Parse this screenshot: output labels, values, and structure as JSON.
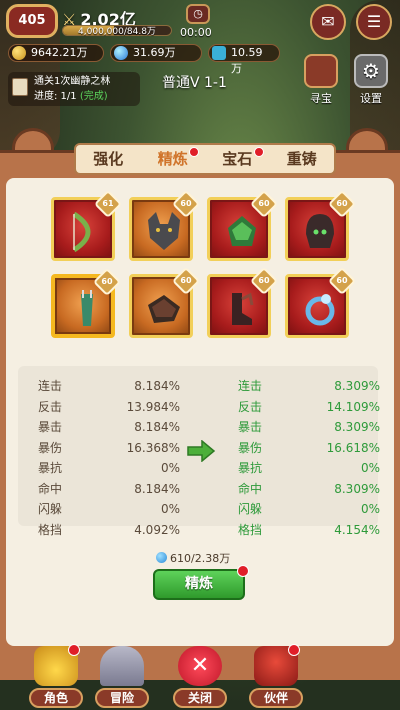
{
  "hud": {
    "level": "405",
    "power": "2.02亿",
    "exp_text": "4,000,000/84.8万",
    "exp_fraction": 0.47,
    "timer": "00:00",
    "gold": "9642.21万",
    "gems": "31.69万",
    "tickets": "10.59万"
  },
  "quest": {
    "title": "通关1次幽静之林",
    "progress_label": "进度: 1/1",
    "status": "(完成)"
  },
  "stage": "普通V 1-1",
  "side_buttons": {
    "treasure": "寻宝",
    "settings": "设置"
  },
  "tabs": [
    {
      "label": "强化",
      "badge": false
    },
    {
      "label": "精炼",
      "badge": true,
      "active": true
    },
    {
      "label": "宝石",
      "badge": true
    },
    {
      "label": "重铸",
      "badge": false
    }
  ],
  "equipment": [
    {
      "name": "bow",
      "level": "61",
      "color": "red"
    },
    {
      "name": "wolf-helmet",
      "level": "60",
      "color": "orange"
    },
    {
      "name": "armor",
      "level": "60",
      "color": "red"
    },
    {
      "name": "helmet",
      "level": "60",
      "color": "red"
    },
    {
      "name": "quiver",
      "level": "60",
      "color": "orange",
      "selected": true
    },
    {
      "name": "gloves",
      "level": "60",
      "color": "orange"
    },
    {
      "name": "boots",
      "level": "60",
      "color": "red"
    },
    {
      "name": "ring",
      "level": "60",
      "color": "red"
    }
  ],
  "stats": {
    "names": [
      "连击",
      "反击",
      "暴击",
      "暴伤",
      "暴抗",
      "命中",
      "闪躲",
      "格挡"
    ],
    "current": [
      "8.184%",
      "13.984%",
      "8.184%",
      "16.368%",
      "0%",
      "8.184%",
      "0%",
      "4.092%"
    ],
    "next": [
      "8.309%",
      "14.109%",
      "8.309%",
      "16.618%",
      "0%",
      "8.309%",
      "0%",
      "4.154%"
    ]
  },
  "refine": {
    "cost": "610/2.38万",
    "button": "精炼"
  },
  "bottom_nav": [
    {
      "label": "角色",
      "icon": "gold-coins-icon",
      "badge": true
    },
    {
      "label": "冒险",
      "icon": "portal-icon",
      "badge": false
    },
    {
      "label": "关闭",
      "icon": "close-icon",
      "badge": false
    },
    {
      "label": "伙伴",
      "icon": "companion-icon",
      "badge": true
    }
  ]
}
